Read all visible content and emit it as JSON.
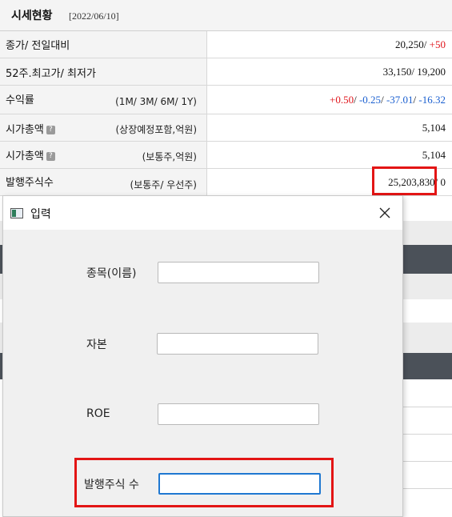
{
  "stock_table": {
    "title": "시세현황",
    "date": "[2022/06/10]",
    "rows": [
      {
        "label": "종가/ 전일대비",
        "sub": "",
        "value_main": "20,250/ ",
        "value_change": "+50"
      },
      {
        "label": "52주.최고가/ 최저가",
        "sub": "",
        "value": "33,150/ 19,200"
      },
      {
        "label": "수익률",
        "sub": "(1M/ 3M/ 6M/ 1Y)",
        "returns": [
          "+0.50",
          "-0.25",
          "-37.01",
          "-16.32"
        ],
        "sep": "/ "
      },
      {
        "label": "시가총액",
        "sub": "(상장예정포함,억원)",
        "value": "5,104",
        "help": "?"
      },
      {
        "label": "시가총액",
        "sub": "(보통주,억원)",
        "value": "5,104",
        "help": "?"
      },
      {
        "label": "발행주식수",
        "sub": "(보통주/ 우선주)",
        "value_main": "25,203,830",
        "value_rest": "/ 0"
      }
    ]
  },
  "dialog": {
    "title": "입력",
    "fields": [
      {
        "label": "종목(이름)",
        "value": ""
      },
      {
        "label": "자본",
        "value": ""
      },
      {
        "label": "ROE",
        "value": ""
      },
      {
        "label": "발행주식 수",
        "value": ""
      }
    ]
  },
  "colors": {
    "highlight": "#e31515",
    "up": "#e0141b",
    "down": "#1a5fd0",
    "focus": "#1f78d1"
  },
  "icons": [
    "help-icon",
    "app-window-icon",
    "close-icon"
  ]
}
